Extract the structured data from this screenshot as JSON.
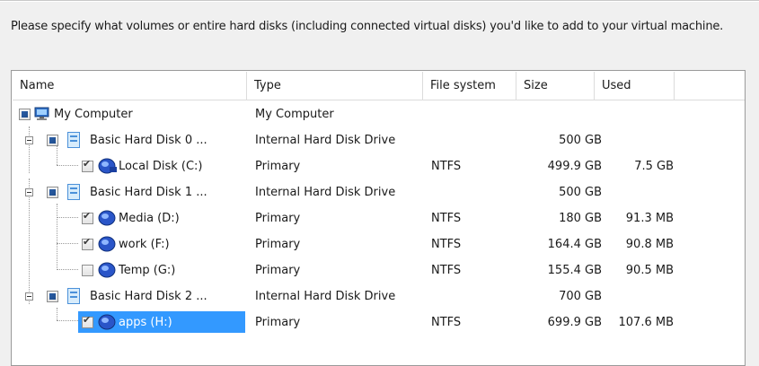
{
  "instruction": "Please specify what volumes or entire hard disks (including connected virtual disks) you'd like to add to your virtual machine.",
  "columns": {
    "name": "Name",
    "type": "Type",
    "file_system": "File system",
    "size": "Size",
    "used": "Used"
  },
  "rows": [
    {
      "name": "My Computer",
      "type": "My Computer",
      "fs": "",
      "size": "",
      "used": ""
    },
    {
      "name": "Basic Hard Disk 0 ...",
      "type": "Internal Hard Disk Drive",
      "fs": "",
      "size": "500 GB",
      "used": ""
    },
    {
      "name": "Local Disk (C:)",
      "type": "Primary",
      "fs": "NTFS",
      "size": "499.9 GB",
      "used": "7.5 GB"
    },
    {
      "name": "Basic Hard Disk 1 ...",
      "type": "Internal Hard Disk Drive",
      "fs": "",
      "size": "500 GB",
      "used": ""
    },
    {
      "name": "Media (D:)",
      "type": "Primary",
      "fs": "NTFS",
      "size": "180 GB",
      "used": "91.3 MB"
    },
    {
      "name": "work (F:)",
      "type": "Primary",
      "fs": "NTFS",
      "size": "164.4 GB",
      "used": "90.8 MB"
    },
    {
      "name": "Temp (G:)",
      "type": "Primary",
      "fs": "NTFS",
      "size": "155.4 GB",
      "used": "90.5 MB"
    },
    {
      "name": "Basic Hard Disk 2 ...",
      "type": "Internal Hard Disk Drive",
      "fs": "",
      "size": "700 GB",
      "used": ""
    },
    {
      "name": "apps (H:)",
      "type": "Primary",
      "fs": "NTFS",
      "size": "699.9 GB",
      "used": "107.6 MB"
    }
  ],
  "checkbox_states": [
    "partial",
    "partial",
    "checked",
    "partial",
    "checked",
    "checked",
    "unchecked",
    "partial",
    "checked"
  ],
  "colors": {
    "selection": "#3399ff",
    "partial_fill": "#1e4c8c",
    "disk_icon": "#4a90d9"
  }
}
